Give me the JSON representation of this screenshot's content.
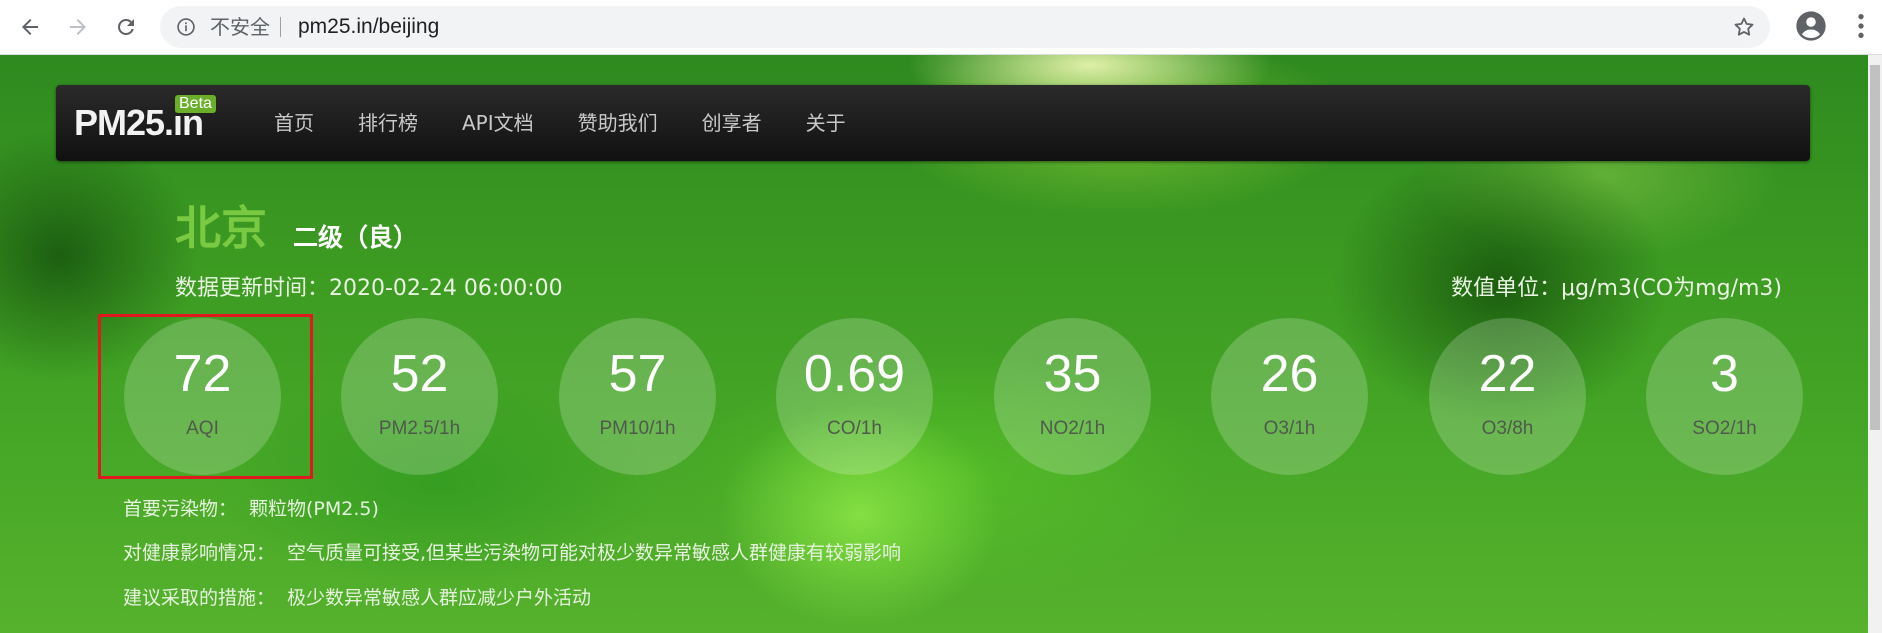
{
  "browser": {
    "insecure_label": "不安全",
    "url": "pm25.in/beijing"
  },
  "navbar": {
    "brand": "PM25.in",
    "beta": "Beta",
    "items": [
      "首页",
      "排行榜",
      "API文档",
      "赞助我们",
      "创享者",
      "关于"
    ]
  },
  "city": {
    "name": "北京",
    "level": "二级（良）",
    "update_time": "数据更新时间：2020-02-24 06:00:00",
    "unit": "数值单位：μg/m3(CO为mg/m3)"
  },
  "metrics": [
    {
      "value": "72",
      "label": "AQI"
    },
    {
      "value": "52",
      "label": "PM2.5/1h"
    },
    {
      "value": "57",
      "label": "PM10/1h"
    },
    {
      "value": "0.69",
      "label": "CO/1h"
    },
    {
      "value": "35",
      "label": "NO2/1h"
    },
    {
      "value": "26",
      "label": "O3/1h"
    },
    {
      "value": "22",
      "label": "O3/8h"
    },
    {
      "value": "3",
      "label": "SO2/1h"
    }
  ],
  "details": {
    "primary_pollutant_label": "首要污染物：",
    "primary_pollutant": "颗粒物(PM2.5)",
    "health_label": "对健康影响情况：",
    "health": "空气质量可接受,但某些污染物可能对极少数异常敏感人群健康有较弱影响",
    "advice_label": "建议采取的措施：",
    "advice": "极少数异常敏感人群应减少户外活动"
  },
  "colors": {
    "city": "#7ac943",
    "highlight": "#e0191e",
    "beta_badge": "#6aae2a"
  }
}
